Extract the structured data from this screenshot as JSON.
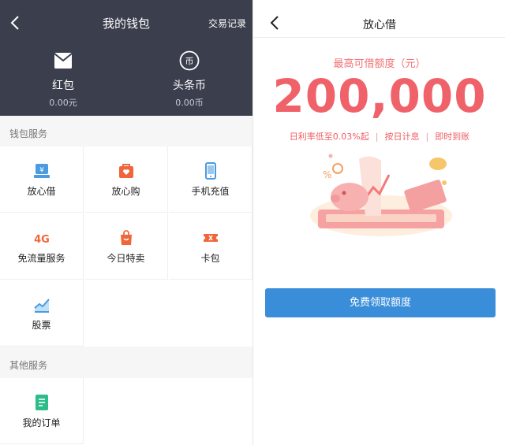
{
  "wallet": {
    "title": "我的钱包",
    "record_label": "交易记录",
    "assets": [
      {
        "name": "红包",
        "value": "0.00元",
        "icon": "envelope-icon"
      },
      {
        "name": "头条币",
        "value": "0.00币",
        "icon": "coin-icon"
      }
    ],
    "section1_title": "钱包服务",
    "services": [
      {
        "label": "放心借",
        "icon": "loan-icon"
      },
      {
        "label": "放心购",
        "icon": "shopping-icon"
      },
      {
        "label": "手机充值",
        "icon": "phone-icon"
      },
      {
        "label": "免流量服务",
        "icon": "4g-icon"
      },
      {
        "label": "今日特卖",
        "icon": "bag-icon"
      },
      {
        "label": "卡包",
        "icon": "ticket-icon"
      },
      {
        "label": "股票",
        "icon": "stock-chart-icon"
      }
    ],
    "section2_title": "其他服务",
    "other_services": [
      {
        "label": "我的订单",
        "icon": "order-icon"
      }
    ],
    "colors": {
      "header_bg": "#3b3e4d"
    }
  },
  "loan": {
    "title": "放心借",
    "quota_label": "最高可借额度（元）",
    "amount": "200,000",
    "features": [
      "日利率低至0.03%起",
      "按日计息",
      "即时到账"
    ],
    "cta_label": "免费领取额度",
    "colors": {
      "accent": "#f0626a",
      "button": "#3a8ed9"
    }
  }
}
